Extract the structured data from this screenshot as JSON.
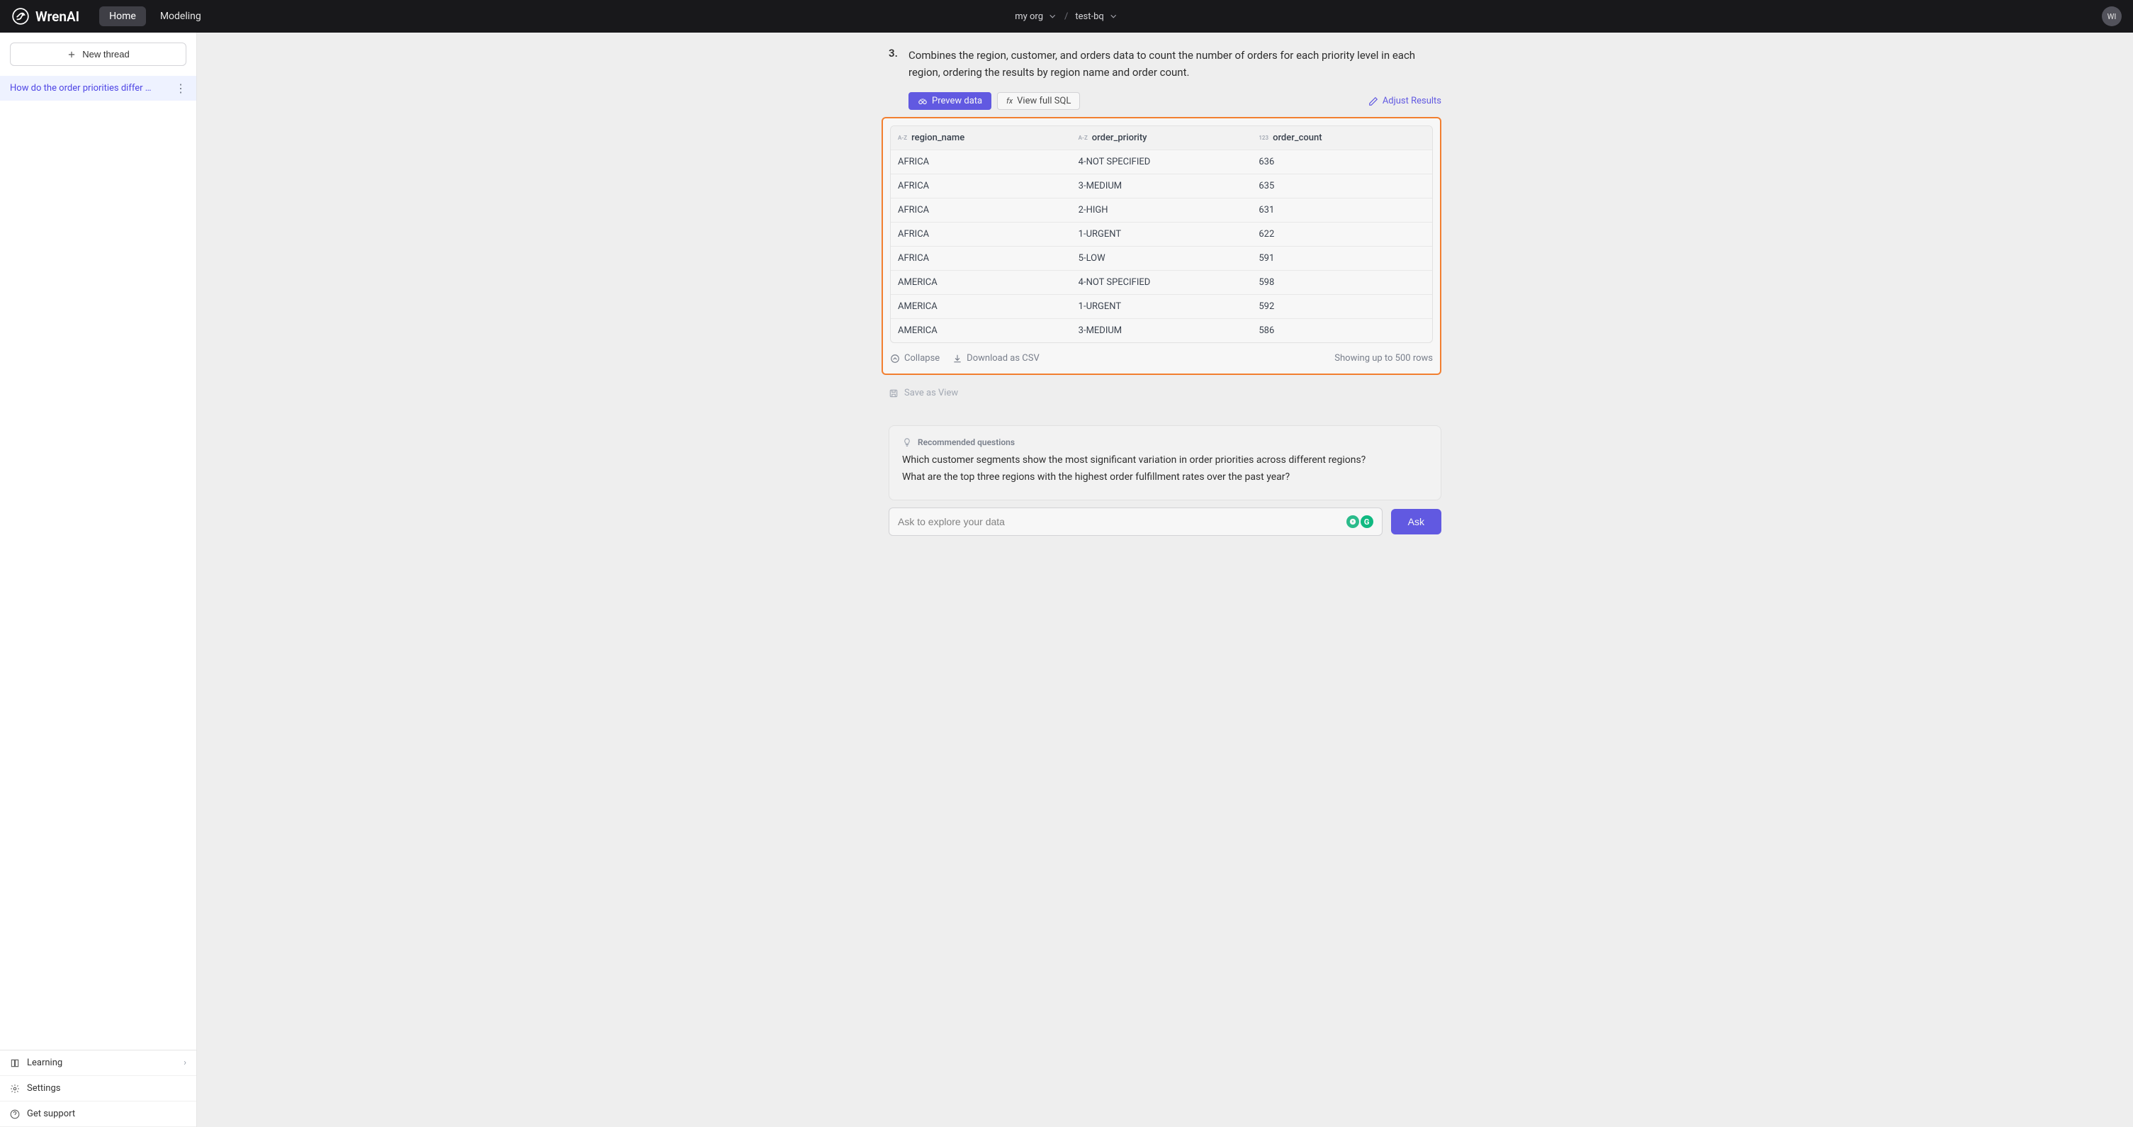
{
  "brand": "WrenAI",
  "nav": {
    "home": "Home",
    "modeling": "Modeling"
  },
  "breadcrumbs": {
    "org": "my org",
    "project": "test-bq"
  },
  "avatar_initials": "WI",
  "sidebar": {
    "new_thread": "New thread",
    "threads": [
      {
        "title": "How do the order priorities differ …"
      }
    ],
    "learning": "Learning",
    "settings": "Settings",
    "support": "Get support"
  },
  "step": {
    "number": "3.",
    "text": "Combines the region, customer, and orders data to count the number of orders for each priority level in each region, ordering the results by region name and order count."
  },
  "toolbar": {
    "preview": "Prevew data",
    "viewsql": "View full SQL",
    "adjust": "Adjust Results"
  },
  "table": {
    "columns": [
      {
        "type": "A-Z",
        "name": "region_name"
      },
      {
        "type": "A-Z",
        "name": "order_priority"
      },
      {
        "type": "123",
        "name": "order_count"
      }
    ],
    "rows": [
      [
        "AFRICA",
        "4-NOT SPECIFIED",
        "636"
      ],
      [
        "AFRICA",
        "3-MEDIUM",
        "635"
      ],
      [
        "AFRICA",
        "2-HIGH",
        "631"
      ],
      [
        "AFRICA",
        "1-URGENT",
        "622"
      ],
      [
        "AFRICA",
        "5-LOW",
        "591"
      ],
      [
        "AMERICA",
        "4-NOT SPECIFIED",
        "598"
      ],
      [
        "AMERICA",
        "1-URGENT",
        "592"
      ],
      [
        "AMERICA",
        "3-MEDIUM",
        "586"
      ]
    ],
    "collapse": "Collapse",
    "download": "Download as CSV",
    "info": "Showing up to 500 rows"
  },
  "save_view": "Save as View",
  "recommended": {
    "title": "Recommended questions",
    "questions": [
      "Which customer segments show the most significant variation in order priorities across different regions?",
      "What are the top three regions with the highest order fulfillment rates over the past year?"
    ]
  },
  "ask": {
    "placeholder": "Ask to explore your data",
    "button": "Ask"
  },
  "chart_data": {
    "type": "table",
    "columns": [
      "region_name",
      "order_priority",
      "order_count"
    ],
    "rows": [
      [
        "AFRICA",
        "4-NOT SPECIFIED",
        636
      ],
      [
        "AFRICA",
        "3-MEDIUM",
        635
      ],
      [
        "AFRICA",
        "2-HIGH",
        631
      ],
      [
        "AFRICA",
        "1-URGENT",
        622
      ],
      [
        "AFRICA",
        "5-LOW",
        591
      ],
      [
        "AMERICA",
        "4-NOT SPECIFIED",
        598
      ],
      [
        "AMERICA",
        "1-URGENT",
        592
      ],
      [
        "AMERICA",
        "3-MEDIUM",
        586
      ]
    ]
  }
}
